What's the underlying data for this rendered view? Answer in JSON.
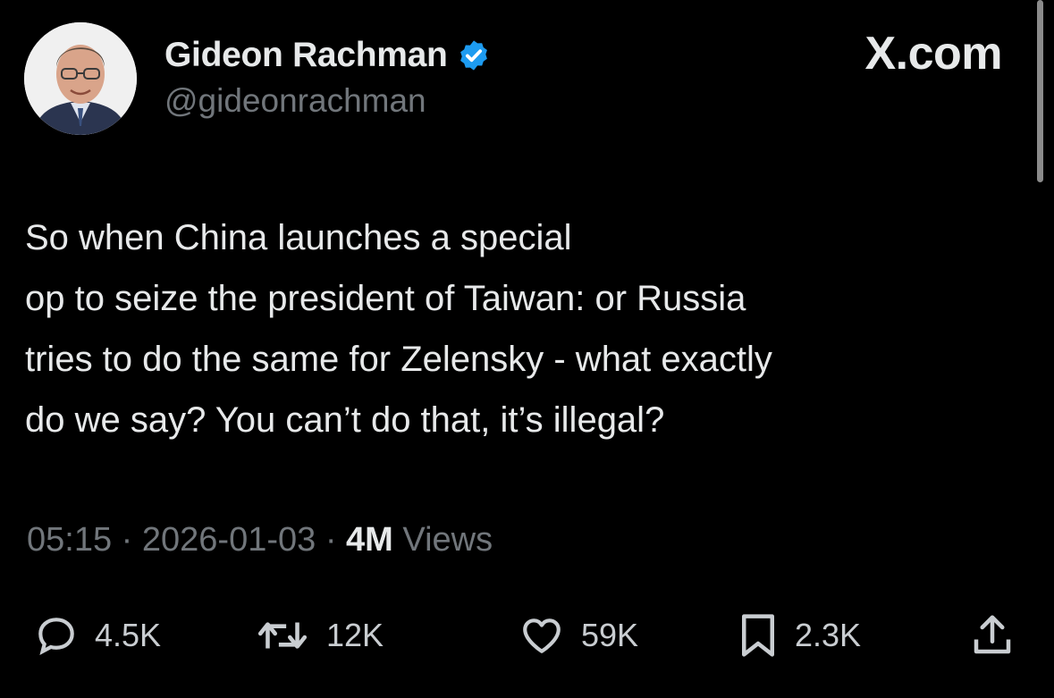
{
  "header": {
    "display_name": "Gideon Rachman",
    "handle": "@gideonrachman",
    "brand": "X.com",
    "verified_color": "#1d9bf0"
  },
  "tweet": {
    "lines": [
      "So when China launches a special",
      "op to seize the president of Taiwan: or Russia",
      "tries to do the same for Zelensky - what exactly",
      "do we say? You can’t do that, it’s illegal?"
    ]
  },
  "meta": {
    "time": "05:15",
    "separator": "·",
    "date": "2026-01-03",
    "views_count": "4M",
    "views_label": "Views"
  },
  "actions": {
    "reply": {
      "icon": "reply-icon",
      "count": "4.5K"
    },
    "repost": {
      "icon": "repost-icon",
      "count": "12K"
    },
    "like": {
      "icon": "heart-icon",
      "count": "59K"
    },
    "bookmark": {
      "icon": "bookmark-icon",
      "count": "2.3K"
    },
    "share": {
      "icon": "share-icon"
    }
  }
}
